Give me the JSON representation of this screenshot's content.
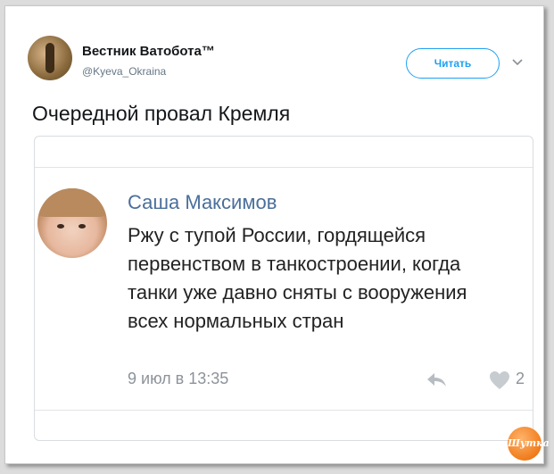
{
  "tweet": {
    "author_name": "Вестник Ватобота™",
    "handle": "@Kyeva_Okraina",
    "follow_label": "Читать",
    "text": "Очередной провал Кремля"
  },
  "embedded_post": {
    "author_name": "Саша Максимов",
    "message": "Ржу с тупой России, гордящейся первенством в танкостроении, когда танки уже давно сняты с вооружения всех нормальных стран",
    "date": "9 июл в 13:35",
    "likes": "2"
  },
  "watermark": {
    "text": "Шутка"
  },
  "colors": {
    "accent": "#1da1f2",
    "name_link": "#4a6f9b",
    "meta_gray": "#8d939a",
    "watermark": "#f07c1c"
  },
  "icons": [
    "chevron-down-icon",
    "reply-icon",
    "heart-icon"
  ]
}
